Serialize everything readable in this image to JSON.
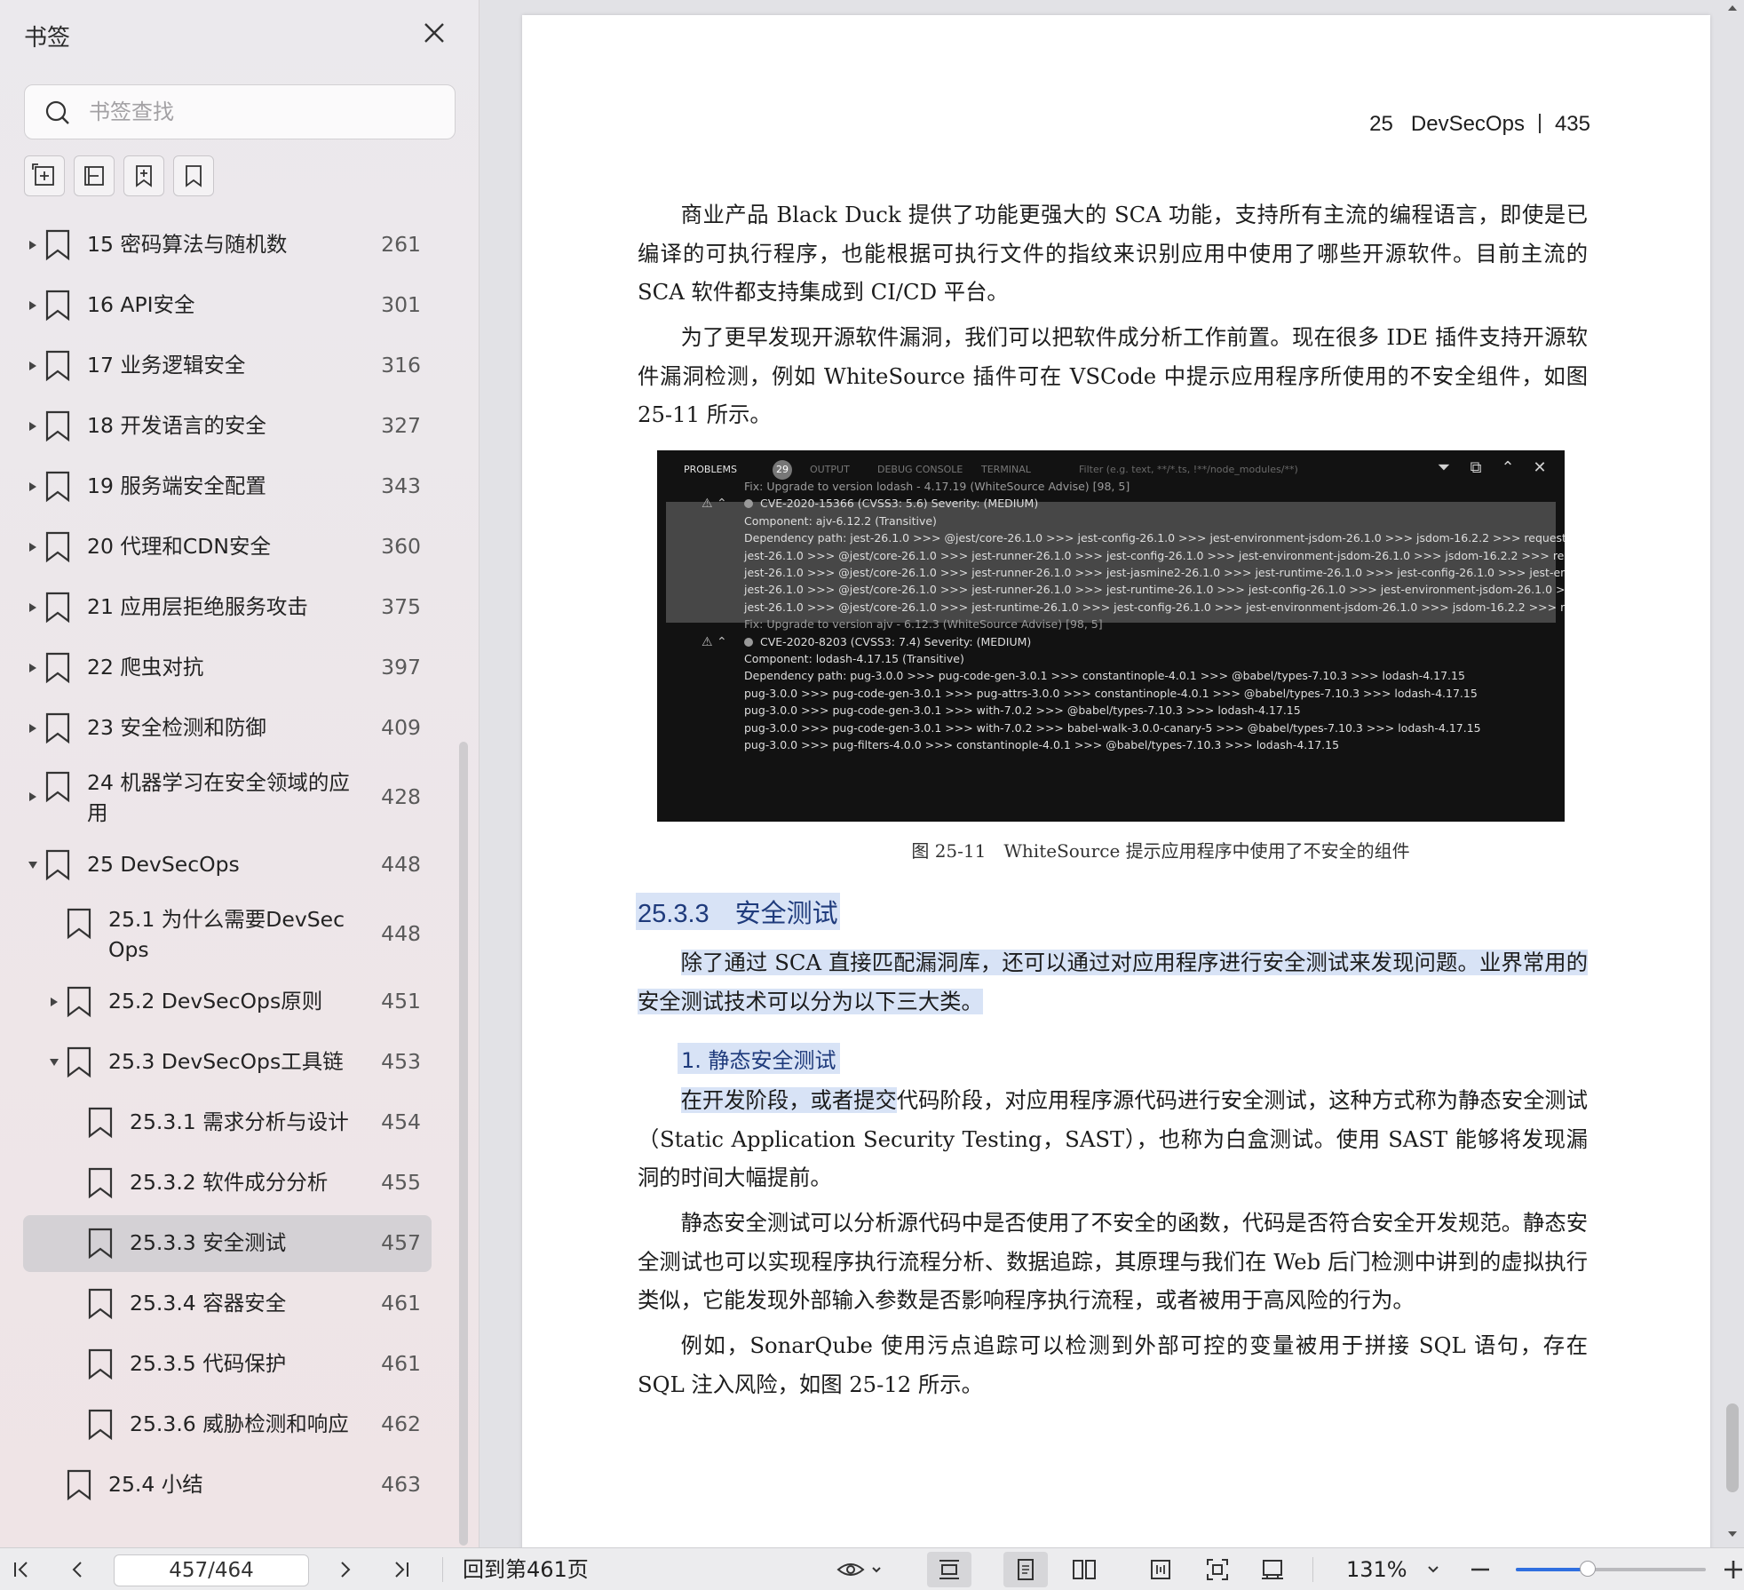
{
  "sidebar": {
    "title": "书签",
    "search_placeholder": "书签查找",
    "tools": [
      "expand-all-icon",
      "collapse-all-icon",
      "add-bookmark-icon",
      "bookmark-icon"
    ],
    "items": [
      {
        "label": "15 密码算法与随机数",
        "page": "261",
        "level": 0,
        "arrow": "right"
      },
      {
        "label": "16 API安全",
        "page": "301",
        "level": 0,
        "arrow": "right"
      },
      {
        "label": "17 业务逻辑安全",
        "page": "316",
        "level": 0,
        "arrow": "right"
      },
      {
        "label": "18 开发语言的安全",
        "page": "327",
        "level": 0,
        "arrow": "right"
      },
      {
        "label": "19 服务端安全配置",
        "page": "343",
        "level": 0,
        "arrow": "right"
      },
      {
        "label": "20 代理和CDN安全",
        "page": "360",
        "level": 0,
        "arrow": "right"
      },
      {
        "label": "21 应用层拒绝服务攻击",
        "page": "375",
        "level": 0,
        "arrow": "right"
      },
      {
        "label": "22 爬虫对抗",
        "page": "397",
        "level": 0,
        "arrow": "right"
      },
      {
        "label": "23 安全检测和防御",
        "page": "409",
        "level": 0,
        "arrow": "right"
      },
      {
        "label": "24 机器学习在安全领域的应用",
        "page": "428",
        "level": 0,
        "arrow": "right",
        "lines": 2
      },
      {
        "label": "25 DevSecOps",
        "page": "448",
        "level": 0,
        "arrow": "down"
      },
      {
        "label": "25.1 为什么需要DevSecOps",
        "page": "448",
        "level": 1,
        "arrow": "",
        "lines": 2
      },
      {
        "label": "25.2 DevSecOps原则",
        "page": "451",
        "level": 1,
        "arrow": "right"
      },
      {
        "label": "25.3 DevSecOps工具链",
        "page": "453",
        "level": 1,
        "arrow": "down"
      },
      {
        "label": "25.3.1 需求分析与设计",
        "page": "454",
        "level": 2,
        "arrow": ""
      },
      {
        "label": "25.3.2 软件成分分析",
        "page": "455",
        "level": 2,
        "arrow": ""
      },
      {
        "label": "25.3.3 安全测试",
        "page": "457",
        "level": 2,
        "arrow": "",
        "active": true
      },
      {
        "label": "25.3.4 容器安全",
        "page": "461",
        "level": 2,
        "arrow": ""
      },
      {
        "label": "25.3.5 代码保护",
        "page": "461",
        "level": 2,
        "arrow": ""
      },
      {
        "label": "25.3.6 威胁检测和响应",
        "page": "462",
        "level": 2,
        "arrow": ""
      },
      {
        "label": "25.4 小结",
        "page": "463",
        "level": 1,
        "arrow": ""
      }
    ]
  },
  "document": {
    "running_head": {
      "chapter": "25",
      "title": "DevSecOps",
      "page": "435"
    },
    "paragraphs": {
      "p1": "商业产品 Black Duck 提供了功能更强大的 SCA 功能，支持所有主流的编程语言，即使是已编译的可执行程序，也能根据可执行文件的指纹来识别应用中使用了哪些开源软件。目前主流的 SCA 软件都支持集成到 CI/CD 平台。",
      "p2": "为了更早发现开源软件漏洞，我们可以把软件成分析工作前置。现在很多 IDE 插件支持开源软件漏洞检测，例如 WhiteSource 插件可在 VSCode 中提示应用程序所使用的不安全组件，如图 25-11 所示。",
      "caption": "图 25-11　WhiteSource 提示应用程序中使用了不安全的组件",
      "section_heading": "25.3.3　安全测试",
      "p3": "除了通过 SCA 直接匹配漏洞库，还可以通过对应用程序进行安全测试来发现问题。业界常用的安全测试技术可以分为以下三大类。",
      "sub_heading": "1. 静态安全测试",
      "p4_hl": "在开发阶段，或者提交",
      "p4_rest": "代码阶段，对应用程序源代码进行安全测试，这种方式称为静态安全测试（Static Application Security Testing，SAST），也称为白盒测试。使用 SAST 能够将发现漏洞的时间大幅提前。",
      "p5": "静态安全测试可以分析源代码中是否使用了不安全的函数，代码是否符合安全开发规范。静态安全测试也可以实现程序执行流程分析、数据追踪，其原理与我们在 Web 后门检测中讲到的虚拟执行类似，它能发现外部输入参数是否影响程序执行流程，或者被用于高风险的行为。",
      "p6": "例如，SonarQube 使用污点追踪可以检测到外部可控的变量被用于拼接 SQL 语句，存在 SQL 注入风险，如图 25-12 所示。"
    },
    "figure": {
      "tabs": [
        "PROBLEMS",
        "OUTPUT",
        "DEBUG CONSOLE",
        "TERMINAL"
      ],
      "badge": "29",
      "filter": "Filter (e.g. text, **/*.ts, !**/node_modules/**)",
      "lines": [
        {
          "text": "Fix: Upgrade to version lodash - 4.17.19 (WhiteSource Advise) [98, 5]",
          "dim": true
        },
        {
          "text": "CVE-2020-15366 (CVSS3: 5.6) Severity: (MEDIUM)",
          "head": true
        },
        {
          "text": "Component: ajv-6.12.2 (Transitive)"
        },
        {
          "text": "Dependency path: jest-26.1.0 >>> @jest/core-26.1.0 >>> jest-config-26.1.0 >>> jest-environment-jsdom-26.1.0 >>> jsdom-16.2.2 >>> request..."
        },
        {
          "text": "jest-26.1.0 >>> @jest/core-26.1.0 >>> jest-runner-26.1.0 >>> jest-config-26.1.0 >>> jest-environment-jsdom-26.1.0 >>> jsdom-16.2.2 >>> req..."
        },
        {
          "text": "jest-26.1.0 >>> @jest/core-26.1.0 >>> jest-runner-26.1.0 >>> jest-jasmine2-26.1.0 >>> jest-runtime-26.1.0 >>> jest-config-26.1.0 >>> jest-env..."
        },
        {
          "text": "jest-26.1.0 >>> @jest/core-26.1.0 >>> jest-runner-26.1.0 >>> jest-runtime-26.1.0 >>> jest-config-26.1.0 >>> jest-environment-jsdom-26.1.0 >..."
        },
        {
          "text": "jest-26.1.0 >>> @jest/core-26.1.0 >>> jest-runtime-26.1.0 >>> jest-config-26.1.0 >>> jest-environment-jsdom-26.1.0 >>> jsdom-16.2.2 >>> re..."
        },
        {
          "text": "Fix: Upgrade to version ajv - 6.12.3 (WhiteSource Advise) [98, 5]",
          "dim": true
        },
        {
          "text": "CVE-2020-8203 (CVSS3: 7.4) Severity: (MEDIUM)",
          "head": true
        },
        {
          "text": "Component: lodash-4.17.15 (Transitive)"
        },
        {
          "text": "Dependency path: pug-3.0.0 >>> pug-code-gen-3.0.1 >>> constantinople-4.0.1 >>> @babel/types-7.10.3 >>> lodash-4.17.15"
        },
        {
          "text": "pug-3.0.0 >>> pug-code-gen-3.0.1 >>> pug-attrs-3.0.0 >>> constantinople-4.0.1 >>> @babel/types-7.10.3 >>> lodash-4.17.15"
        },
        {
          "text": "pug-3.0.0 >>> pug-code-gen-3.0.1 >>> with-7.0.2 >>> @babel/types-7.10.3 >>> lodash-4.17.15"
        },
        {
          "text": "pug-3.0.0 >>> pug-code-gen-3.0.1 >>> with-7.0.2 >>> babel-walk-3.0.0-canary-5 >>> @babel/types-7.10.3 >>> lodash-4.17.15"
        },
        {
          "text": "pug-3.0.0 >>> pug-filters-4.0.0 >>> constantinople-4.0.1 >>> @babel/types-7.10.3 >>> lodash-4.17.15"
        }
      ]
    }
  },
  "toolbar": {
    "page_indicator": "457/464",
    "back_label": "回到第461页",
    "zoom": "131%",
    "zoom_fraction": 0.38
  },
  "colors": {
    "highlight": "#d8e3f6",
    "heading": "#1f3b7c",
    "accent": "#2f6fe0"
  }
}
